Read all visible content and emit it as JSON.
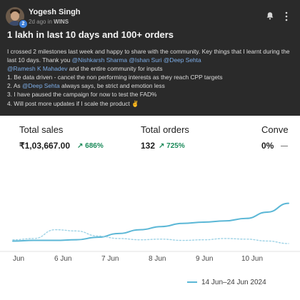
{
  "post": {
    "author": "Yogesh Singh",
    "badge": "2",
    "time": "2d ago in",
    "group": "WINS",
    "title": "1 lakh in last 10 days and 100+ orders",
    "body": [
      [
        "I crossed 2 milestones last week and happy to share with the community. Key things that I learnt during the last 10 days. Thank you "
      ],
      [
        "@Nishkarsh Sharma"
      ],
      [
        " "
      ],
      [
        "@Ishan Suri"
      ],
      [
        " "
      ],
      [
        "@Deep Sehta"
      ],
      [
        "@Ramesh K Mahadev"
      ],
      [
        " and the entire community for inputs"
      ],
      [
        "1. Be data driven - cancel the non performing interests as they reach CPP targets"
      ],
      [
        "2. As "
      ],
      [
        "@Deep Sehta"
      ],
      [
        " always says, be strict and emotion less"
      ],
      [
        "3. I have paused the campaign for now to test the FAD%"
      ],
      [
        "4. Will post more updates if I scale the product ✌"
      ]
    ]
  },
  "metrics": {
    "total_sales_label": "Total sales",
    "total_sales_value": "₹1,03,667.00",
    "total_sales_delta": "↗ 686%",
    "total_orders_label": "Total orders",
    "total_orders_value": "132",
    "total_orders_delta": "↗ 725%",
    "conv_label": "Conve",
    "conv_value": "0%",
    "conv_delta": "—"
  },
  "chart_data": {
    "type": "line",
    "x": [
      "Jun",
      "6 Jun",
      "7 Jun",
      "8 Jun",
      "9 Jun",
      "10 Jun"
    ],
    "series": [
      {
        "values": [
          0.12,
          0.13,
          0.13,
          0.14,
          0.18,
          0.24,
          0.3,
          0.35,
          0.4,
          0.42,
          0.44,
          0.48,
          0.58,
          0.72
        ]
      },
      {
        "values": [
          0.14,
          0.16,
          0.3,
          0.28,
          0.2,
          0.16,
          0.14,
          0.15,
          0.13,
          0.14,
          0.16,
          0.15,
          0.12,
          0.08
        ]
      }
    ],
    "legend": "14 Jun–24 Jun 2024",
    "colors": {
      "primary": "#5bb7d6",
      "comparison": "#9fd3e6"
    }
  }
}
